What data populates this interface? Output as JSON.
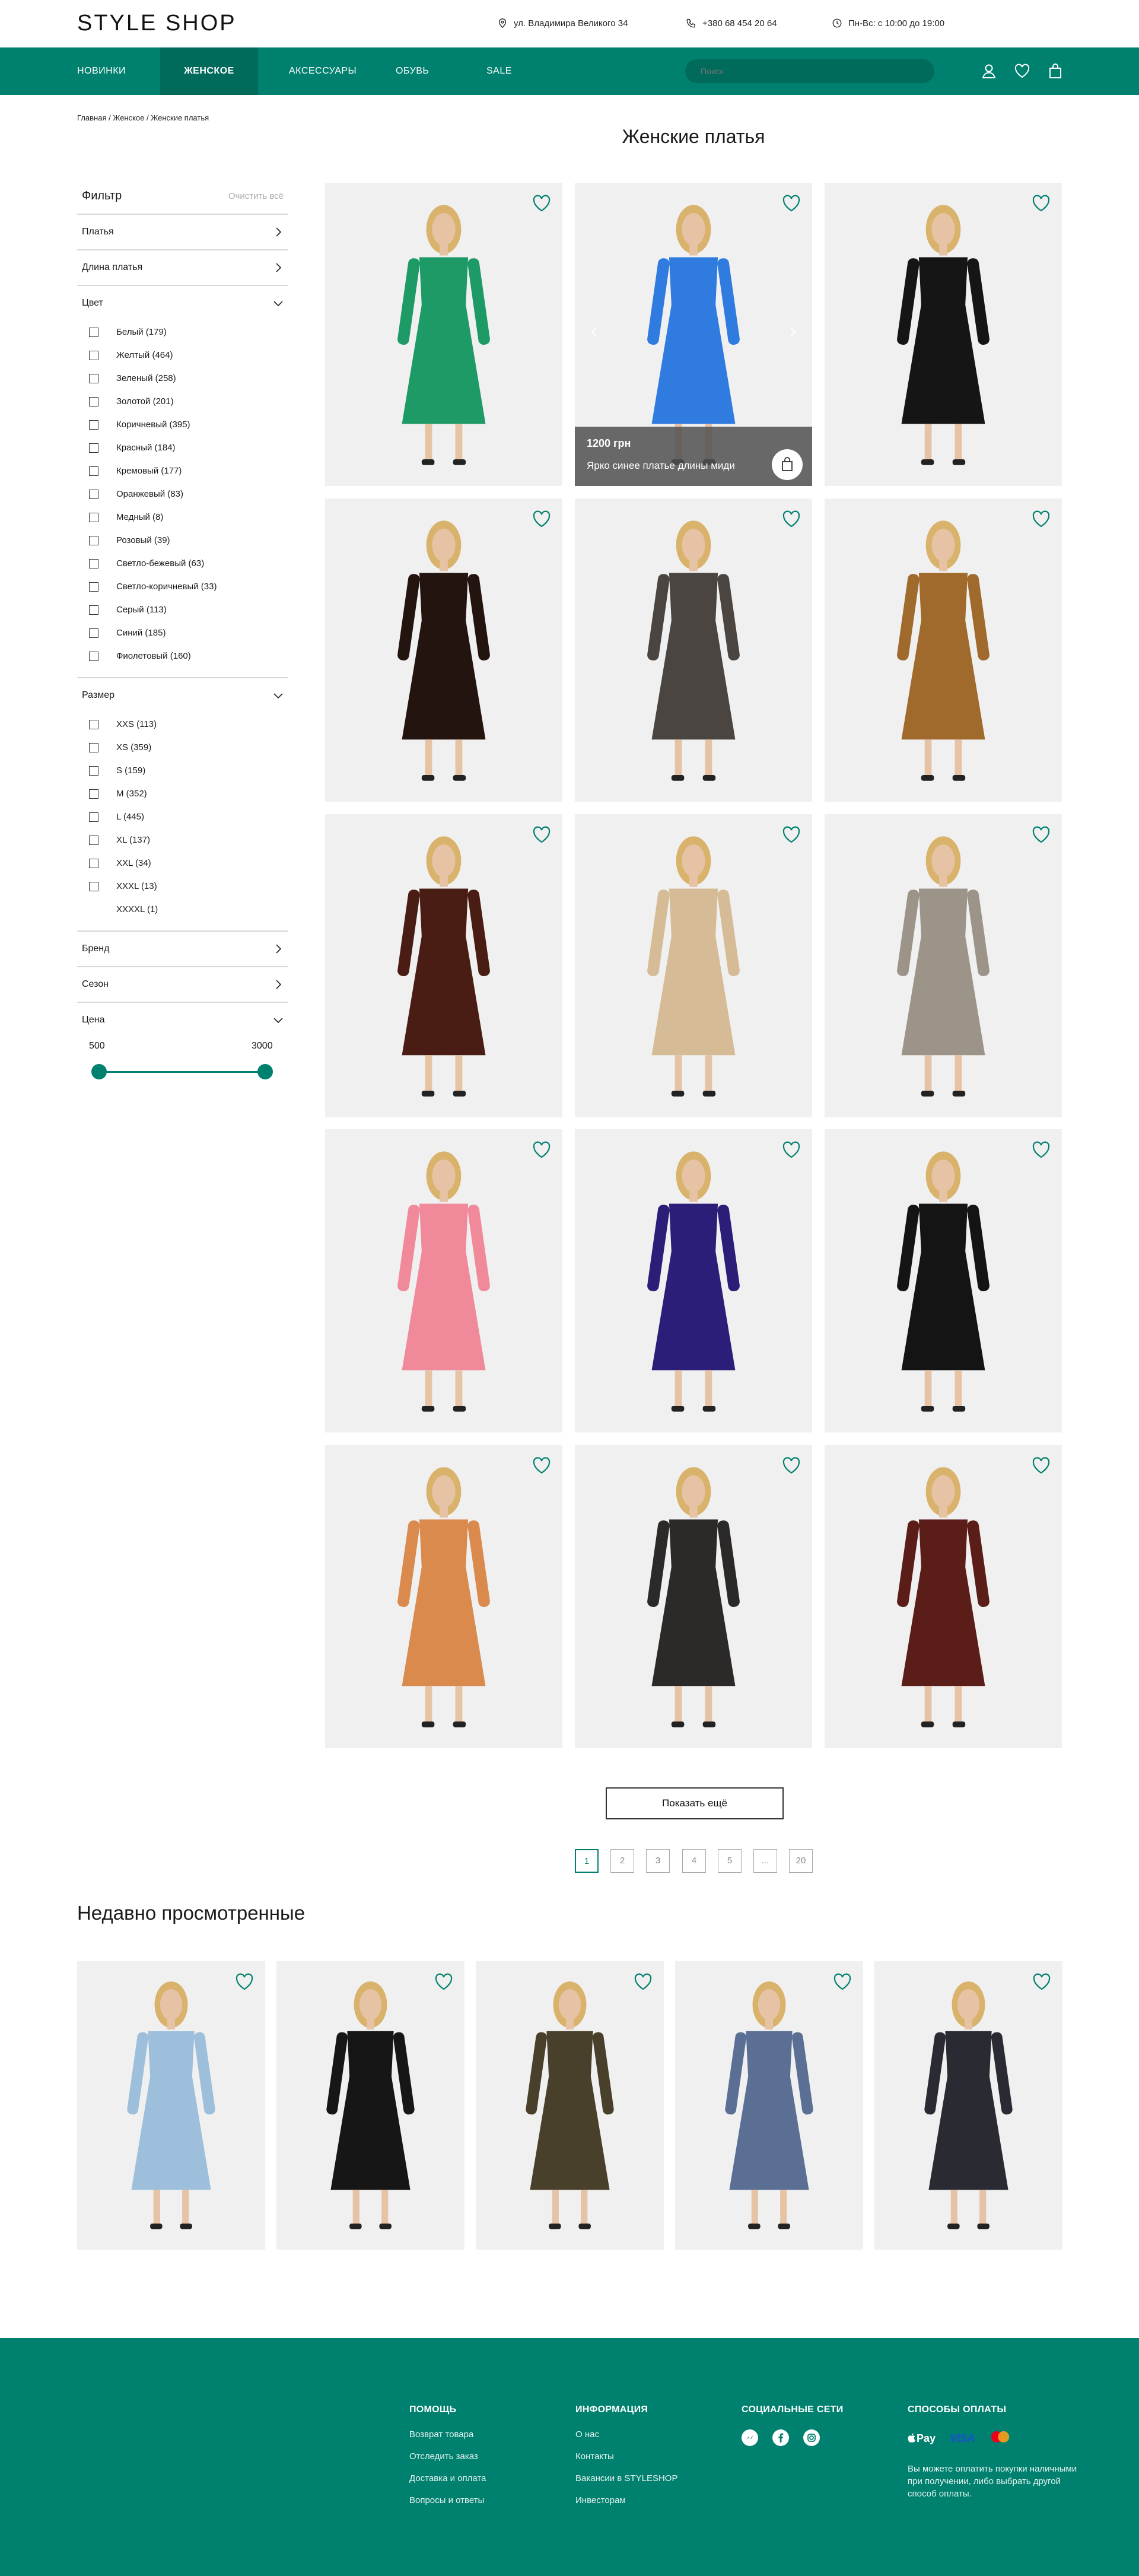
{
  "header": {
    "logo": "STYLE SHOP",
    "address": "ул. Владимира Великого 34",
    "phone": "+380 68 454 20 64",
    "hours": "Пн-Вс: с 10:00 до 19:00"
  },
  "nav": {
    "items": [
      "НОВИНКИ",
      "ЖЕНСКОЕ",
      "АКСЕССУАРЫ",
      "ОБУВЬ",
      "SALE"
    ],
    "search_placeholder": "Поиск"
  },
  "breadcrumb": [
    "Главная",
    "Женское",
    "Женские платья"
  ],
  "page_title": "Женские платья",
  "filter": {
    "title": "Фильтр",
    "clear": "Очистить всё",
    "sections": {
      "dresses": "Платья",
      "length": "Длина платья",
      "color": "Цвет",
      "size": "Размер",
      "brand": "Бренд",
      "season": "Сезон",
      "price": "Цена"
    },
    "colors": [
      "Белый (179)",
      "Желтый (464)",
      "Зеленый (258)",
      "Золотой (201)",
      "Коричневый (395)",
      "Красный (184)",
      "Кремовый (177)",
      "Оранжевый (83)",
      "Медный (8)",
      "Розовый (39)",
      "Светло-бежевый (63)",
      "Светло-коричневый (33)",
      "Серый (113)",
      "Синий (185)",
      "Фиолетовый (160)"
    ],
    "sizes": [
      "XXS (113)",
      "XS (359)",
      "S (159)",
      "M (352)",
      "L (445)",
      "XL (137)",
      "XXL (34)",
      "XXXL (13)",
      "XXXXL (1)"
    ],
    "price_min": "500",
    "price_max": "3000"
  },
  "hover_card": {
    "price": "1200 грн",
    "name": "Ярко синее платье длины миди"
  },
  "products": [
    {
      "dress": "#1e9a66",
      "skin": "#e7c3a6",
      "hair": "#d9b26b"
    },
    {
      "dress": "#2f7be0",
      "skin": "#e7c3a6",
      "hair": "#d9b26b"
    },
    {
      "dress": "#151515",
      "skin": "#e7c3a6",
      "hair": "#d9b26b"
    },
    {
      "dress": "#24140f",
      "skin": "#e7c3a6",
      "hair": "#d9b26b"
    },
    {
      "dress": "#4a4540",
      "skin": "#e7c3a6",
      "hair": "#d9b26b"
    },
    {
      "dress": "#a06a2c",
      "skin": "#e7c3a6",
      "hair": "#d9b26b"
    },
    {
      "dress": "#4a1d14",
      "skin": "#e7c3a6",
      "hair": "#d9b26b"
    },
    {
      "dress": "#d6bc96",
      "skin": "#e7c3a6",
      "hair": "#d9b26b"
    },
    {
      "dress": "#9c9488",
      "skin": "#e7c3a6",
      "hair": "#d9b26b"
    },
    {
      "dress": "#f08a9a",
      "skin": "#e7c3a6",
      "hair": "#d9b26b"
    },
    {
      "dress": "#2a1e78",
      "skin": "#e7c3a6",
      "hair": "#d9b26b"
    },
    {
      "dress": "#141414",
      "skin": "#e7c3a6",
      "hair": "#d9b26b"
    },
    {
      "dress": "#d98a4c",
      "skin": "#e7c3a6",
      "hair": "#d9b26b"
    },
    {
      "dress": "#2c2a28",
      "skin": "#e7c3a6",
      "hair": "#d9b26b"
    },
    {
      "dress": "#5a1d18",
      "skin": "#e7c3a6",
      "hair": "#d9b26b"
    }
  ],
  "show_more": "Показать ещё",
  "pagination": [
    "1",
    "2",
    "3",
    "4",
    "5",
    "...",
    "20"
  ],
  "recent": {
    "title": "Недавно просмотренные",
    "items": [
      {
        "dress": "#9dbfdb",
        "skin": "#e7c3a6",
        "hair": "#d9b26b"
      },
      {
        "dress": "#161616",
        "skin": "#e7c3a6",
        "hair": "#d9b26b"
      },
      {
        "dress": "#48402a",
        "skin": "#e7c3a6",
        "hair": "#d9b26b"
      },
      {
        "dress": "#5b6f94",
        "skin": "#e7c3a6",
        "hair": "#d9b26b"
      },
      {
        "dress": "#2a2a33",
        "skin": "#e7c3a6",
        "hair": "#d9b26b"
      }
    ]
  },
  "footer": {
    "help": {
      "title": "ПОМОЩЬ",
      "links": [
        "Возврат товара",
        "Отследить заказ",
        "Доставка и оплата",
        "Вопросы и ответы"
      ]
    },
    "info": {
      "title": "ИНФОРМАЦИЯ",
      "links": [
        "О нас",
        "Контакты",
        "Вакансии в STYLESHOP",
        "Инвесторам"
      ]
    },
    "social": {
      "title": "СОЦИАЛЬНЫЕ СЕТИ"
    },
    "payment": {
      "title": "СПОСОБЫ ОПЛАТЫ",
      "apple_pay": "Pay",
      "visa": "VISA",
      "note": "Вы можете оплатить покупки наличными при получении, либо выбрать другой способ оплаты."
    }
  },
  "colors": {
    "accent": "#00806e",
    "accent_dark": "#006a5b"
  }
}
